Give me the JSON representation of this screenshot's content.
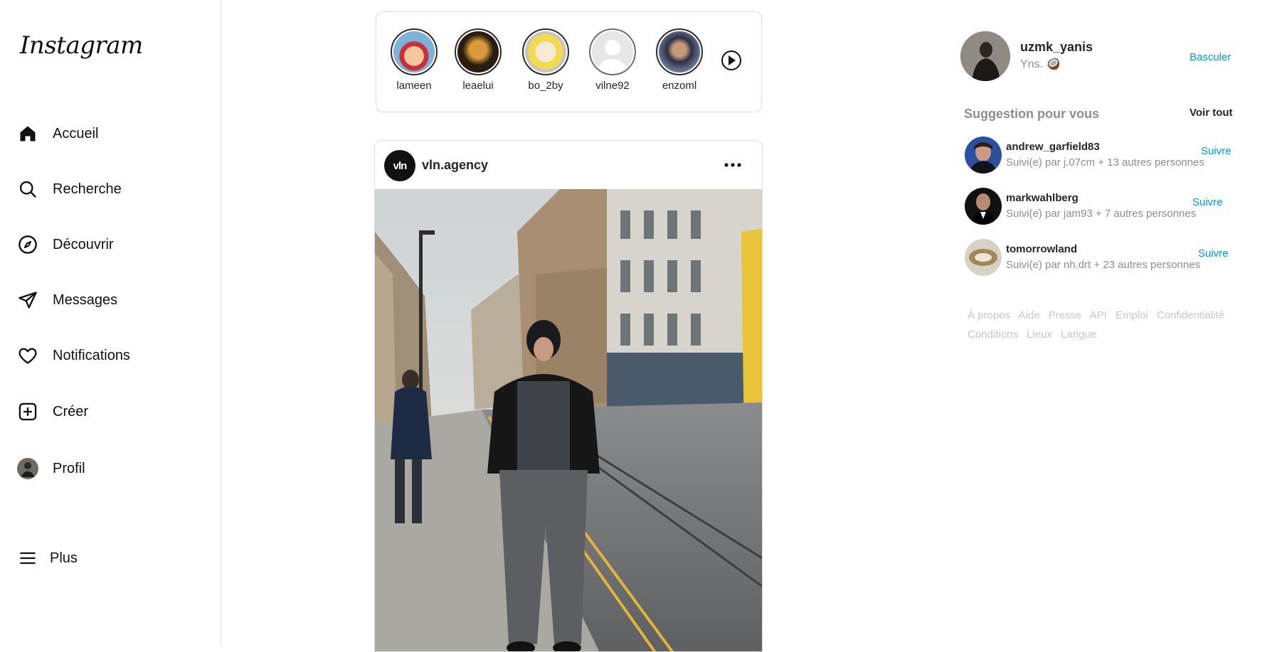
{
  "brand": {
    "logo_text": "Instagram"
  },
  "nav": {
    "items": [
      {
        "label": "Accueil",
        "icon": "home-icon"
      },
      {
        "label": "Recherche",
        "icon": "search-icon"
      },
      {
        "label": "Découvrir",
        "icon": "compass-icon"
      },
      {
        "label": "Messages",
        "icon": "paper-plane-icon"
      },
      {
        "label": "Notifications",
        "icon": "heart-icon"
      },
      {
        "label": "Créer",
        "icon": "plus-square-icon"
      },
      {
        "label": "Profil",
        "icon": "avatar"
      }
    ],
    "more": {
      "label": "Plus",
      "icon": "hamburger-icon"
    }
  },
  "stories": {
    "items": [
      {
        "name": "lameen"
      },
      {
        "name": "leaelui"
      },
      {
        "name": "bo_2by"
      },
      {
        "name": "vilne92"
      },
      {
        "name": "enzoml"
      }
    ],
    "next_icon": "chevron-right-circle-icon"
  },
  "post": {
    "username": "vln.agency",
    "avatar_text": "vln",
    "more_icon": "more-horizontal-icon"
  },
  "profile": {
    "username": "uzmk_yanis",
    "subtitle": "Yns. 🥥",
    "switch_label": "Basculer"
  },
  "suggestions": {
    "title": "Suggestion pour vous",
    "see_all": "Voir tout",
    "items": [
      {
        "username": "andrew_garfield83",
        "meta": "Suivi(e) par j.07cm + 13 autres personnes",
        "follow": "Suivre"
      },
      {
        "username": "markwahlberg",
        "meta": "Suivi(e) par jam93 + 7 autres personnes",
        "follow": "Suivre"
      },
      {
        "username": "tomorrowland",
        "meta": "Suivi(e) par nh.drt + 23 autres personnes",
        "follow": "Suivre"
      }
    ]
  },
  "footer": {
    "links": [
      "À propos",
      "Aide",
      "Presse",
      "API",
      "Emploi",
      "Confidentialité",
      "Conditions",
      "Lieux",
      "Langue"
    ]
  },
  "colors": {
    "link": "#0095f6",
    "muted": "#8e8e8e",
    "border": "#dbdbdb"
  }
}
